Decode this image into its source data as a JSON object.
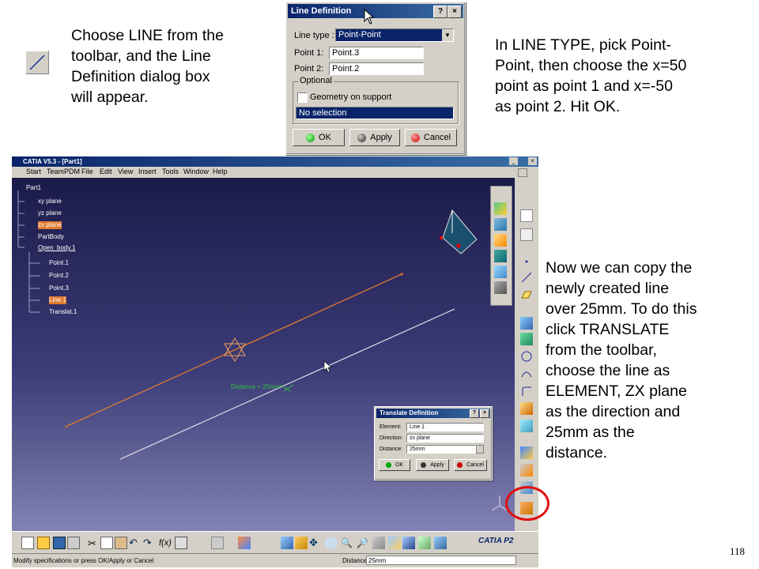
{
  "slide": {
    "text_top_left": "Choose LINE from the\ntoolbar, and the Line\nDefinition dialog box\nwill appear.",
    "text_top_right": "In LINE TYPE, pick Point-\nPoint, then choose the x=50\npoint as point 1 and x=-50\nas point 2. Hit OK.",
    "text_right": "Now we can copy the\nnewly created line\nover 25mm. To do this\nclick TRANSLATE\nfrom the toolbar,\nchoose the line as\nELEMENT, ZX plane\nas the direction and\n25mm as the\ndistance.",
    "page_number": "118"
  },
  "line_dialog": {
    "title": "Line Definition",
    "help": "?",
    "close": "×",
    "line_type_label": "Line type :",
    "line_type_value": "Point-Point",
    "point1_label": "Point 1:",
    "point1_value": "Point.3",
    "point2_label": "Point 2:",
    "point2_value": "Point.2",
    "optional_label": "Optional",
    "geometry_support_label": "Geometry on support",
    "selection_value": "No selection",
    "ok": "OK",
    "apply": "Apply",
    "cancel": "Cancel"
  },
  "catia": {
    "title": "CATIA V5.3 - [Part1]",
    "menu": [
      "Start",
      "TeamPDM",
      "File",
      "Edit",
      "View",
      "Insert",
      "Tools",
      "Window",
      "Help"
    ],
    "tree": {
      "root": "Part1",
      "items": [
        "xy plane",
        "yz plane",
        "zx plane",
        "PartBody",
        "Open_body.1"
      ],
      "children": [
        "Point.1",
        "Point.2",
        "Point.3",
        "Line.1",
        "Translat.1"
      ]
    },
    "distance_label": "Distance = 25mm",
    "status_text": "Modify specifications or press OK/Apply or Cancel",
    "status_distance_label": "Distance",
    "status_distance_value": "25mm",
    "logo": "CATIA P2"
  },
  "translate_dialog": {
    "title": "Translate Definition",
    "help": "?",
    "close": "×",
    "element_label": "Element:",
    "element_value": "Line.1",
    "direction_label": "Direction:",
    "direction_value": "zx plane",
    "distance_label": "Distance:",
    "distance_value": "25mm",
    "ok": "OK",
    "apply": "Apply",
    "cancel": "Cancel"
  },
  "colors": {
    "viewport_top": "#1b1b4a",
    "viewport_bottom": "#8282b4",
    "line_orange": "#e07a30",
    "line_white": "#e8e8f0",
    "highlight_red": "#e01010"
  }
}
